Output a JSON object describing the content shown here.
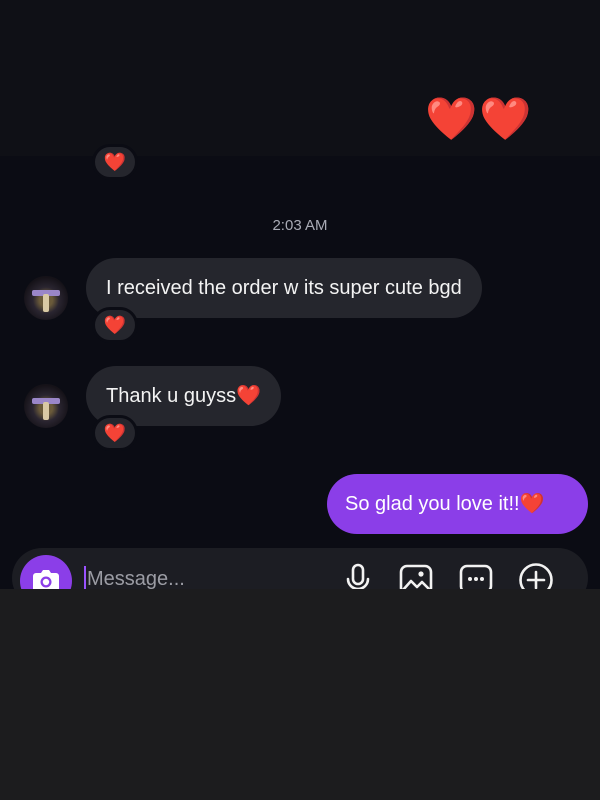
{
  "reactions": {
    "top_hearts": "❤️❤️",
    "heart": "❤️"
  },
  "thread": {
    "timestamp": "2:03 AM",
    "messages": [
      {
        "from": "them",
        "text": "I received the order w its super cute bgd"
      },
      {
        "from": "them",
        "text": "Thank u guyss",
        "emoji": "❤️"
      },
      {
        "from": "me",
        "text": "So glad you love it!!",
        "emoji": "❤️"
      }
    ]
  },
  "composer": {
    "placeholder": "Message...",
    "value": ""
  },
  "icons": {
    "camera": "camera-icon",
    "mic": "microphone-icon",
    "gallery": "image-icon",
    "sticker": "chat-bubble-icon",
    "add": "plus-circle-icon"
  },
  "colors": {
    "sent_bubble": "#8b3ee8",
    "received_bubble": "#25262d",
    "background": "#0b0c14",
    "heart": "#ff2b3c"
  }
}
